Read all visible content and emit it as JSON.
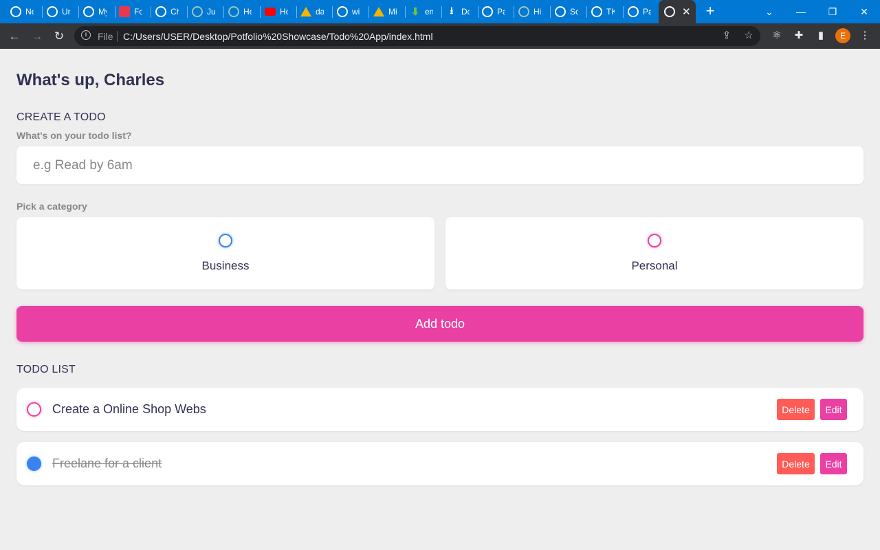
{
  "browser": {
    "tabs": [
      {
        "label": "Ne",
        "icon": "chrome-icon",
        "color": "#ffffff"
      },
      {
        "label": "Ur",
        "icon": "globe-icon",
        "color": "#ffffff"
      },
      {
        "label": "My",
        "icon": "globe-icon",
        "color": "#ffffff"
      },
      {
        "label": "Fo",
        "icon": "figma-like-icon",
        "color": "#e8384f"
      },
      {
        "label": "Ch",
        "icon": "openai-icon",
        "color": "#ffffff"
      },
      {
        "label": "Ju",
        "icon": "chatgpt-icon",
        "color": "#9ec5b8"
      },
      {
        "label": "He",
        "icon": "chatgpt-icon",
        "color": "#9ec5b8"
      },
      {
        "label": "Ho",
        "icon": "youtube-icon",
        "color": "#ff0000"
      },
      {
        "label": "da",
        "icon": "drive-icon",
        "color": "#f4b400"
      },
      {
        "label": "wi",
        "icon": "globe-icon",
        "color": "#ffffff"
      },
      {
        "label": "Mi",
        "icon": "drive-icon",
        "color": "#f4b400"
      },
      {
        "label": "en",
        "icon": "download-arrow-icon",
        "color": "#6ac33a"
      },
      {
        "label": "Dc",
        "icon": "download-icon",
        "color": "#ffffff"
      },
      {
        "label": "Pa",
        "icon": "github-icon",
        "color": "#ffffff"
      },
      {
        "label": "Hi",
        "icon": "chatgpt-icon",
        "color": "#9ec5b8"
      },
      {
        "label": "Sc",
        "icon": "globe-icon",
        "color": "#ffffff"
      },
      {
        "label": "TK",
        "icon": "globe-icon",
        "color": "#ffffff"
      },
      {
        "label": "Pa",
        "icon": "globe-icon",
        "color": "#ffffff"
      }
    ],
    "active_tab_icon": "globe-icon",
    "file_label": "File",
    "url": "C:/Users/USER/Desktop/Potfolio%20Showcase/Todo%20App/index.html",
    "profile_initial": "E"
  },
  "app": {
    "greeting": "What's up, Charles",
    "create_title": "CREATE A TODO",
    "input_label": "What's on your todo list?",
    "input_placeholder": "e.g Read by 6am",
    "category_label": "Pick a category",
    "categories": [
      {
        "label": "Business",
        "color": "#3a82ee"
      },
      {
        "label": "Personal",
        "color": "#ea40a4"
      }
    ],
    "add_button": "Add todo",
    "list_title": "TODO LIST",
    "todos": [
      {
        "text": "Create a Online Shop Website",
        "category": "Personal",
        "done": false,
        "delete_label": "Delete",
        "edit_label": "Edit"
      },
      {
        "text": "Freelane for a client",
        "category": "Business",
        "done": true,
        "delete_label": "Delete",
        "edit_label": "Edit"
      }
    ]
  },
  "colors": {
    "accent_pink": "#ea40a4",
    "accent_blue": "#3a82ee",
    "danger": "#ff5b57",
    "text_dark": "#313154",
    "background": "#eeeeee"
  }
}
